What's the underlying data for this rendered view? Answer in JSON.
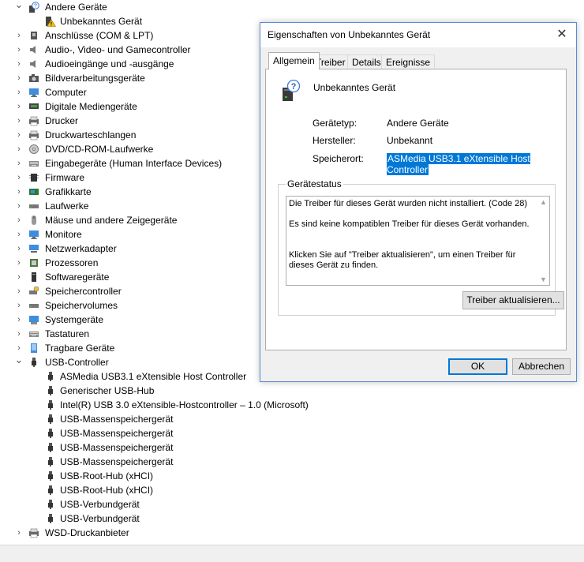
{
  "tree": {
    "rows": [
      {
        "kind": "cat",
        "expanded": true,
        "icon": "unknown-device-icon",
        "label": "Andere Geräte"
      },
      {
        "kind": "child",
        "icon": "warning-device-icon",
        "label": "Unbekanntes Gerät"
      },
      {
        "kind": "cat",
        "icon": "port-icon",
        "label": "Anschlüsse (COM & LPT)"
      },
      {
        "kind": "cat",
        "icon": "speaker-icon",
        "label": "Audio-, Video- und Gamecontroller"
      },
      {
        "kind": "cat",
        "icon": "speaker-icon",
        "label": "Audioeingänge und -ausgänge"
      },
      {
        "kind": "cat",
        "icon": "camera-icon",
        "label": "Bildverarbeitungsgeräte"
      },
      {
        "kind": "cat",
        "icon": "monitor-icon",
        "label": "Computer"
      },
      {
        "kind": "cat",
        "icon": "media-device-icon",
        "label": "Digitale Mediengeräte"
      },
      {
        "kind": "cat",
        "icon": "printer-icon",
        "label": "Drucker"
      },
      {
        "kind": "cat",
        "icon": "printer-icon",
        "label": "Druckwarteschlangen"
      },
      {
        "kind": "cat",
        "icon": "disc-drive-icon",
        "label": "DVD/CD-ROM-Laufwerke"
      },
      {
        "kind": "cat",
        "icon": "keyboard-icon",
        "label": "Eingabegeräte (Human Interface Devices)"
      },
      {
        "kind": "cat",
        "icon": "chip-icon",
        "label": "Firmware"
      },
      {
        "kind": "cat",
        "icon": "graphics-card-icon",
        "label": "Grafikkarte"
      },
      {
        "kind": "cat",
        "icon": "disk-drive-icon",
        "label": "Laufwerke"
      },
      {
        "kind": "cat",
        "icon": "mouse-icon",
        "label": "Mäuse und andere Zeigegeräte"
      },
      {
        "kind": "cat",
        "icon": "monitor-icon",
        "label": "Monitore"
      },
      {
        "kind": "cat",
        "icon": "network-icon",
        "label": "Netzwerkadapter"
      },
      {
        "kind": "cat",
        "icon": "processor-icon",
        "label": "Prozessoren"
      },
      {
        "kind": "cat",
        "icon": "software-device-icon",
        "label": "Softwaregeräte"
      },
      {
        "kind": "cat",
        "icon": "storage-controller-icon",
        "label": "Speichercontroller"
      },
      {
        "kind": "cat",
        "icon": "disk-drive-icon",
        "label": "Speichervolumes"
      },
      {
        "kind": "cat",
        "icon": "system-device-icon",
        "label": "Systemgeräte"
      },
      {
        "kind": "cat",
        "icon": "keyboard-icon",
        "label": "Tastaturen"
      },
      {
        "kind": "cat",
        "icon": "portable-device-icon",
        "label": "Tragbare Geräte"
      },
      {
        "kind": "cat",
        "expanded": true,
        "icon": "usb-icon",
        "label": "USB-Controller"
      },
      {
        "kind": "child",
        "icon": "usb-icon",
        "label": "ASMedia USB3.1 eXtensible Host Controller"
      },
      {
        "kind": "child",
        "icon": "usb-icon",
        "label": "Generischer USB-Hub"
      },
      {
        "kind": "child",
        "icon": "usb-icon",
        "label": "Intel(R) USB 3.0 eXtensible-Hostcontroller – 1.0 (Microsoft)"
      },
      {
        "kind": "child",
        "icon": "usb-icon",
        "label": "USB-Massenspeichergerät"
      },
      {
        "kind": "child",
        "icon": "usb-icon",
        "label": "USB-Massenspeichergerät"
      },
      {
        "kind": "child",
        "icon": "usb-icon",
        "label": "USB-Massenspeichergerät"
      },
      {
        "kind": "child",
        "icon": "usb-icon",
        "label": "USB-Massenspeichergerät"
      },
      {
        "kind": "child",
        "icon": "usb-icon",
        "label": "USB-Root-Hub (xHCI)"
      },
      {
        "kind": "child",
        "icon": "usb-icon",
        "label": "USB-Root-Hub (xHCI)"
      },
      {
        "kind": "child",
        "icon": "usb-icon",
        "label": "USB-Verbundgerät"
      },
      {
        "kind": "child",
        "icon": "usb-icon",
        "label": "USB-Verbundgerät"
      },
      {
        "kind": "cat",
        "icon": "printer-icon",
        "label": "WSD-Druckanbieter"
      }
    ]
  },
  "dialog": {
    "title": "Eigenschaften von Unbekanntes Gerät",
    "tabs": [
      "Allgemein",
      "Treiber",
      "Details",
      "Ereignisse"
    ],
    "active_tab": "Allgemein",
    "device_name": "Unbekanntes Gerät",
    "properties": {
      "type_key": "Gerätetyp:",
      "type_value": "Andere Geräte",
      "manufacturer_key": "Hersteller:",
      "manufacturer_value": "Unbekannt",
      "location_key": "Speicherort:",
      "location_value": "ASMedia USB3.1 eXtensible Host Controller"
    },
    "status": {
      "legend": "Gerätestatus",
      "line1": "Die Treiber für dieses Gerät wurden nicht installiert. (Code 28)",
      "line2": "Es sind keine kompatiblen Treiber für dieses Gerät vorhanden.",
      "line3": "Klicken Sie auf \"Treiber aktualisieren\", um einen Treiber für dieses Gerät zu finden."
    },
    "update_button": "Treiber aktualisieren...",
    "ok_button": "OK",
    "cancel_button": "Abbrechen"
  },
  "colors": {
    "accent": "#0078d7",
    "dialog_border": "#5a8bd6",
    "dialog_bg": "#f0f0f0"
  }
}
